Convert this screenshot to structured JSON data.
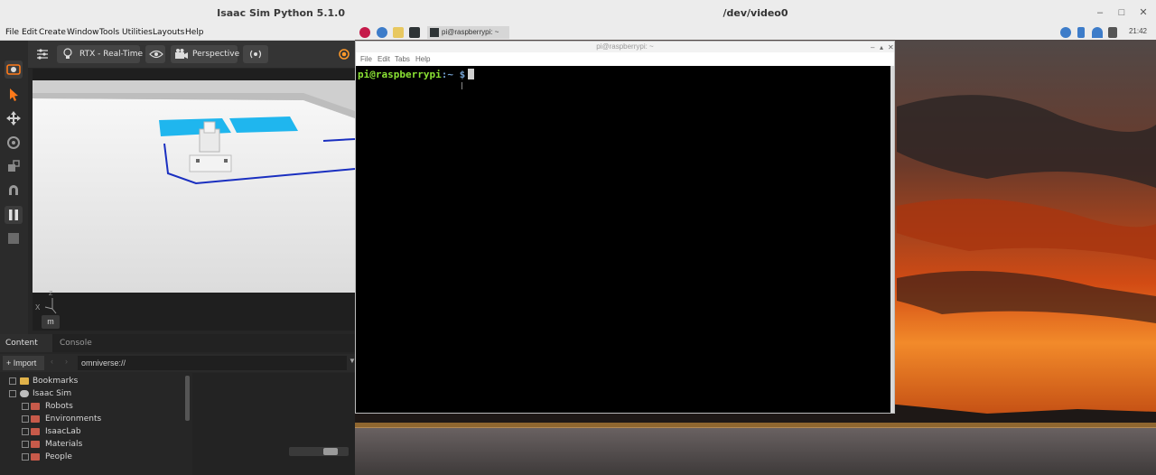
{
  "isaac": {
    "title": "Isaac Sim Python 5.1.0",
    "menu": [
      "File",
      "Edit",
      "Create",
      "Window",
      "Tools",
      "Utilities",
      "Layouts",
      "Help"
    ],
    "viewport": {
      "render_mode": "RTX - Real-Time",
      "camera": "Perspective",
      "unit": "m",
      "axis_x": "X",
      "axis_z": "Z"
    },
    "content": {
      "tabs": [
        "Content",
        "Console"
      ],
      "import_label": "Import",
      "path": "omniverse://",
      "tree": [
        "Bookmarks",
        "Isaac Sim",
        "Robots",
        "Environments",
        "IsaacLab",
        "Materials",
        "People"
      ]
    }
  },
  "video": {
    "title": "/dev/video0",
    "taskbar_label": "pi@raspberrypi: ~",
    "clock": "21:42",
    "terminal": {
      "title": "pi@raspberrypi: ~",
      "menu": [
        "File",
        "Edit",
        "Tabs",
        "Help"
      ],
      "prompt_user": "pi@raspberrypi",
      "prompt_path": ":~",
      "prompt_sign": " $"
    }
  }
}
